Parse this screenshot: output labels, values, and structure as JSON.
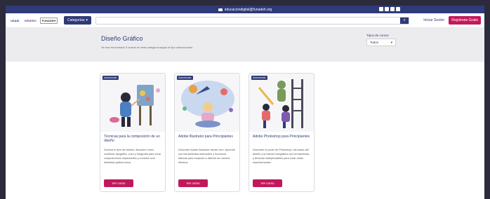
{
  "topbar": {
    "email": "educaciondigital@funadeh.org",
    "social_icons": [
      "facebook-icon",
      "instagram-icon",
      "whatsapp-icon",
      "twitter-icon"
    ]
  },
  "nav": {
    "logos": [
      "USAID",
      "GÉNERO",
      "FUNADEH"
    ],
    "categories_label": "Categorías",
    "search_placeholder": "",
    "login_label": "Iniciar Sesión",
    "register_label": "Regístrate Gratis"
  },
  "hero": {
    "title": "Diseño Gráfico",
    "subtitle": "Se han encontrado 3 cursos en esta categoría según el tipo seleccionado",
    "filter_label": "Tipos de cursos",
    "filter_value": "Todos"
  },
  "cards": [
    {
      "badge": "Autoestudio",
      "title": "Técnicas para la composición de un diseño",
      "description": "Domina el arte del diseño, descubre cómo combinar tipografía, color y fotografía para crear composiciones impactantes y construir una identidad gráfica única.",
      "button": "Ver curso"
    },
    {
      "badge": "Autoestudio",
      "title": "Adobe Illustrator para Principiantes",
      "description": "Descubre Adobe Illustrator desde cero. Aprende sus herramientas esenciales y funciones básicas para empezar a diseñar de manera efectiva.",
      "button": "Ver curso"
    },
    {
      "badge": "Autoestudio",
      "title": "Adobe Photoshop para Principiantes",
      "description": "Descubre el poder de Photoshop, las bases del diseño y la edición fotográfica con herramientas y técnicas indispensables para crear obras impresionantes.",
      "button": "Ver curso"
    }
  ],
  "colors": {
    "primary": "#2f3a78",
    "accent": "#c2185b",
    "hero_bg": "#ececee"
  }
}
